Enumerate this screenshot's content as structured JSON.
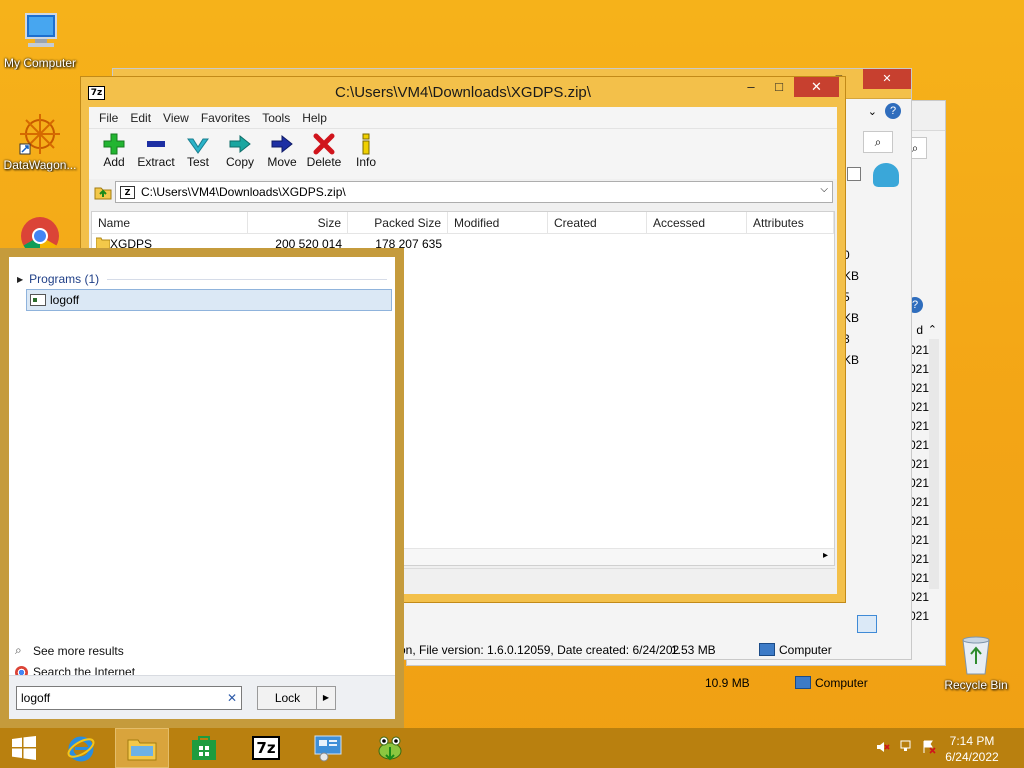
{
  "desktop": {
    "icons": [
      {
        "label": "My Computer"
      },
      {
        "label": "DataWagon..."
      },
      {
        "label": "Recycle Bin"
      }
    ]
  },
  "back_window": {
    "status_meta": "on, File version: 1.6.0.12059, Date created: 6/24/202",
    "status_size": "1.53 MB",
    "status_location": "Computer",
    "status2_size": "10.9 MB",
    "status2_location": "Computer",
    "size_col": [
      "0 KB",
      "5 KB",
      "3 KB"
    ],
    "date_col": [
      "021",
      "021",
      "021",
      "021",
      "021",
      "021",
      "021",
      "021",
      "021",
      "021",
      "021",
      "021",
      "021",
      "021",
      "021"
    ],
    "col_label": "d"
  },
  "sevenzip": {
    "title": "C:\\Users\\VM4\\Downloads\\XGDPS.zip\\",
    "app_icon": "7z",
    "menu": [
      "File",
      "Edit",
      "View",
      "Favorites",
      "Tools",
      "Help"
    ],
    "toolbar": [
      {
        "label": "Add",
        "icon": "add-icon"
      },
      {
        "label": "Extract",
        "icon": "extract-icon"
      },
      {
        "label": "Test",
        "icon": "test-icon"
      },
      {
        "label": "Copy",
        "icon": "copy-icon"
      },
      {
        "label": "Move",
        "icon": "move-icon"
      },
      {
        "label": "Delete",
        "icon": "delete-icon"
      },
      {
        "label": "Info",
        "icon": "info-icon"
      }
    ],
    "address": "C:\\Users\\VM4\\Downloads\\XGDPS.zip\\",
    "columns": [
      "Name",
      "Size",
      "Packed Size",
      "Modified",
      "Created",
      "Accessed",
      "Attributes"
    ],
    "rows": [
      {
        "name": "XGDPS",
        "size": "200 520 014",
        "packed": "178 207 635"
      }
    ]
  },
  "search": {
    "group_label": "Programs (1)",
    "result_label": "logoff",
    "see_more": "See more results",
    "search_internet": "Search the Internet",
    "query": "logoff",
    "power_button": "Lock"
  },
  "taskbar": {
    "time": "7:14 PM",
    "date": "6/24/2022",
    "sevenzip_icon": "7z"
  },
  "colors": {
    "desktop": "#f3a516",
    "taskbar": "#b9800f",
    "window_frame": "#f3c04a",
    "close_button": "#c7402f",
    "accent_link": "#1f3f87"
  }
}
